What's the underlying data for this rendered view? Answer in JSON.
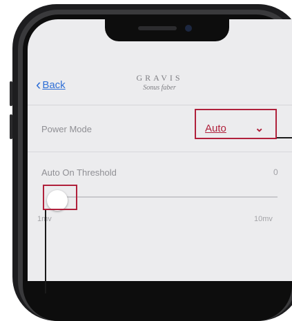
{
  "nav": {
    "back_label": "Back",
    "back_icon": "chevron-left-icon",
    "logo_top": "GRAVIS",
    "logo_bottom": "Sonus faber"
  },
  "settings": {
    "power_mode": {
      "label": "Power Mode",
      "value": "Auto",
      "icon": "chevron-down-icon"
    },
    "auto_on_threshold": {
      "label": "Auto On Threshold",
      "value": "0",
      "min_label": "1mv",
      "max_label": "10mv",
      "slider_fraction": 0.0
    }
  },
  "colors": {
    "accent": "#b0203b",
    "link": "#2f6fd6",
    "screen_bg": "#ececee",
    "label": "#8f8f94"
  }
}
